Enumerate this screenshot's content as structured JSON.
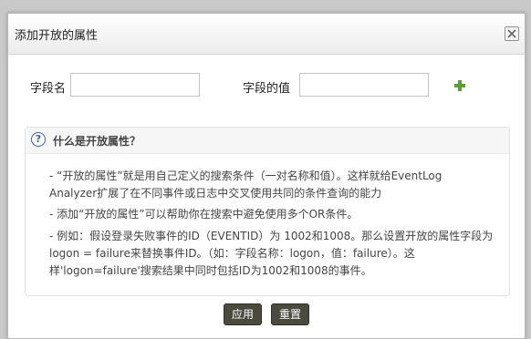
{
  "dialog": {
    "title": "添加开放的属性",
    "field_name_label": "字段名",
    "field_value_label": "字段的值",
    "field_name_value": "",
    "field_value_value": "",
    "info": {
      "title": "什么是开放属性？",
      "bullet1_line1": "- “开放的属性”就是用自己定义的搜索条件（一对名称和值）。这样就给EventLog",
      "bullet1_line2": "Analyzer扩展了在不同事件或日志中交叉使用共同的条件查询的能力",
      "bullet2": "- 添加“开放的属性”可以帮助你在搜索中避免使用多个OR条件。",
      "bullet3_line1": "- 例如：假设登录失败事件的ID（EVENTID）为 1002和1008。那么设置开放的属性字段为",
      "bullet3_line2": "logon = failure来替换事件ID。（如：字段名称：logon，值：failure）。这",
      "bullet3_line3": "样'logon=failure'搜索结果中同时包括ID为1002和1008的事件。"
    },
    "apply_label": "应用",
    "reset_label": "重置"
  }
}
